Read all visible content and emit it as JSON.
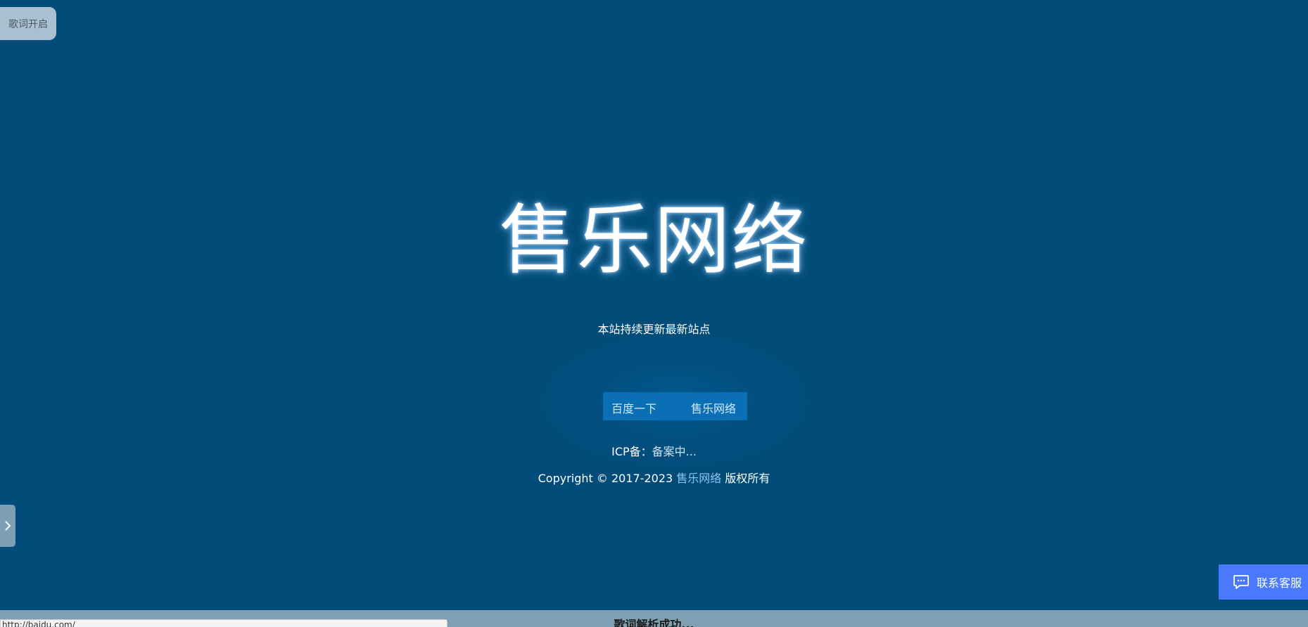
{
  "lyrics": {
    "toggle_label": "歌词开启",
    "status_text": "歌词解析成功..."
  },
  "hero": {
    "title": "售乐网络",
    "subtitle": "本站持续更新最新站点"
  },
  "links": [
    {
      "label": "百度一下"
    },
    {
      "label": "售乐网络"
    }
  ],
  "footer": {
    "icp_prefix": "ICP备：",
    "icp_value": "备案中...",
    "copyright_prefix": "Copyright © 2017-2023 ",
    "copyright_brand": "售乐网络",
    "copyright_suffix": " 版权所有"
  },
  "service": {
    "label": "联系客服",
    "icon": "chat-icon"
  },
  "side_panel": {
    "icon": "chevron-right-icon"
  },
  "status_bar": {
    "url": "http://baidu.com/"
  },
  "colors": {
    "background": "#024c79",
    "button_group": "#0a6fb5",
    "service_button": "#4a79ff",
    "link_accent": "#8cc4ee"
  }
}
